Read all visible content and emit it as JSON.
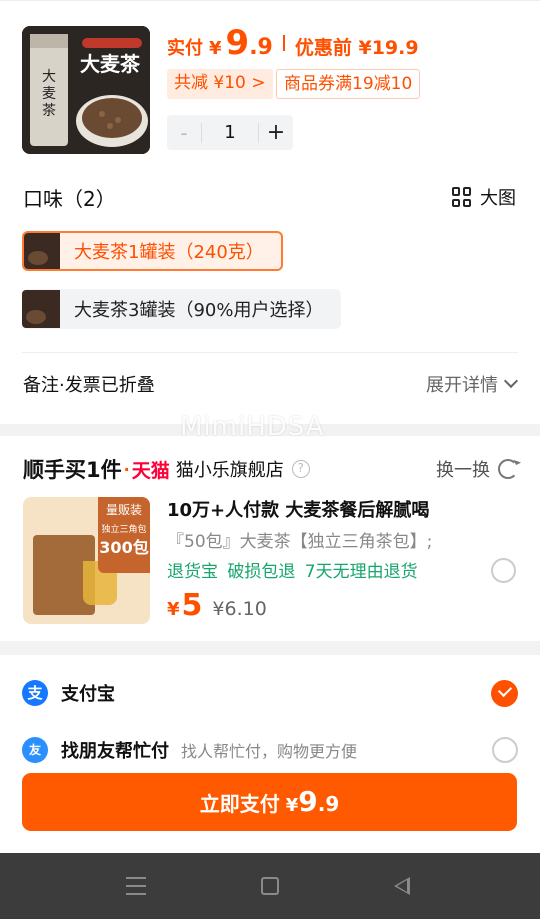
{
  "product": {
    "pay_label": "实付",
    "currency": "¥",
    "price_int": "9",
    "price_dec": ".9",
    "original_label": "优惠前 ¥19.9",
    "reduce_tag": "共减 ¥10 >",
    "coupon_tag": "商品券满19减10",
    "quantity": "1",
    "minus": "-",
    "plus": "+",
    "image_label": "大麦茶"
  },
  "flavor": {
    "title": "口味（2）",
    "big_view": "大图",
    "options": [
      {
        "label": "大麦茶1罐装（240克）",
        "selected": true
      },
      {
        "label": "大麦茶3罐装（90%用户选择）",
        "selected": false
      }
    ]
  },
  "note": {
    "label": "备注·发票已折叠",
    "expand": "展开详情"
  },
  "watermark": "MimiHDSA",
  "recommend": {
    "title": "顺手买1件",
    "dot": "·",
    "tmall": "天猫",
    "shop": "猫小乐旗舰店",
    "help": "?",
    "swap": "换一换",
    "name": "10万+人付款 大麦茶餐后解腻喝",
    "desc": "『50包』大麦茶【独立三角茶包】;",
    "service": "退货宝 破损包退 7天无理由退货",
    "currency": "¥",
    "price": "5",
    "orig_price": "¥6.10",
    "badge_line1": "量贩装",
    "badge_line2": "独立三角包",
    "badge_count": "300包"
  },
  "payment": {
    "alipay_icon": "支",
    "alipay": "支付宝",
    "friend_icon": "友",
    "friend": "找朋友帮忙付",
    "friend_sub": "找人帮忙付，购物更方便",
    "button_label": "立即支付",
    "button_currency": "¥",
    "button_int": "9",
    "button_dec": ".9"
  },
  "colors": {
    "accent": "#ff5000",
    "green": "#17a56b",
    "tmall": "#ff0036",
    "alipay": "#1677ff"
  }
}
